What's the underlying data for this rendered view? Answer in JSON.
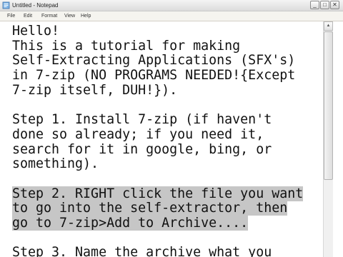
{
  "window": {
    "title": "Untitled - Notepad"
  },
  "menu": {
    "items": [
      "File",
      "Edit",
      "Format",
      "View",
      "Help"
    ]
  },
  "document": {
    "lines": [
      "Hello!",
      "This is a tutorial for making",
      "Self-Extracting Applications (SFX's)",
      "in 7-zip (NO PROGRAMS NEEDED!{Except",
      "7-zip itself, DUH!}).",
      "",
      "Step 1. Install 7-zip (if haven't",
      "done so already; if you need it,",
      "search for it in google, bing, or",
      "something).",
      "",
      "Step 2. RIGHT click the file you want",
      "to go into the self-extractor, then",
      "go to 7-zip>Add to Archive....",
      "",
      "Step 3. Name the archive what you"
    ],
    "selected_lines": [
      11,
      12,
      13
    ]
  }
}
